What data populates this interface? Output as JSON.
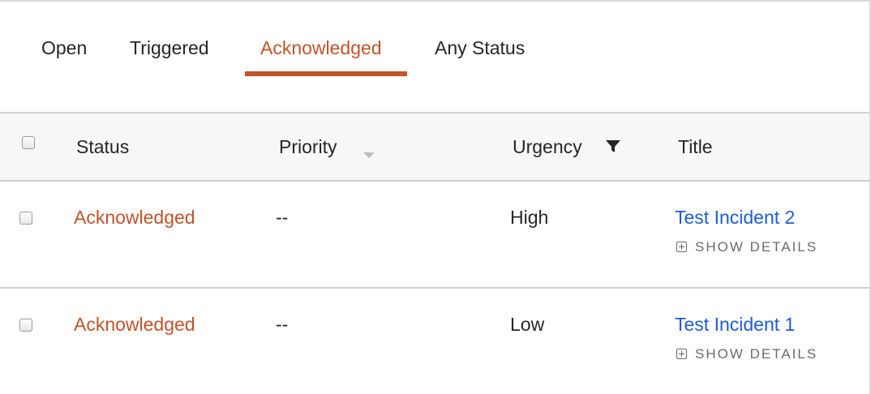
{
  "tabs": [
    {
      "label": "Open",
      "active": false
    },
    {
      "label": "Triggered",
      "active": false
    },
    {
      "label": "Acknowledged",
      "active": true
    },
    {
      "label": "Any Status",
      "active": false
    }
  ],
  "table": {
    "columns": {
      "status": "Status",
      "priority": "Priority",
      "urgency": "Urgency",
      "title": "Title"
    },
    "rows": [
      {
        "status": "Acknowledged",
        "priority": "--",
        "urgency": "High",
        "title": "Test Incident 2",
        "details_label": "SHOW DETAILS"
      },
      {
        "status": "Acknowledged",
        "priority": "--",
        "urgency": "Low",
        "title": "Test Incident 1",
        "details_label": "SHOW DETAILS"
      }
    ]
  },
  "icons": {
    "sort": "sort-caret-down-icon",
    "filter": "filter-funnel-icon",
    "details": "plus-square-icon"
  },
  "colors": {
    "accent": "#c2532a",
    "link": "#1d5dd8",
    "header_bg": "#f7f7f7",
    "divider": "#cfcfcf"
  }
}
